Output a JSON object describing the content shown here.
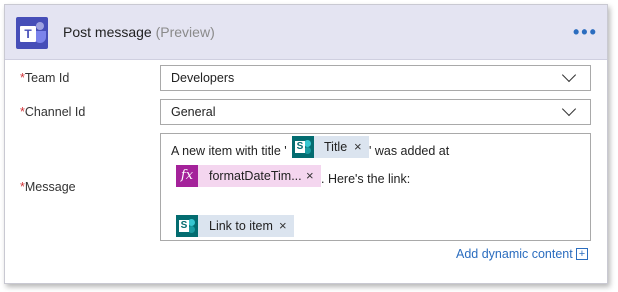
{
  "action": {
    "title": "Post message",
    "preview_tag": "(Preview)",
    "more_label": "•••",
    "logo_letter": "T"
  },
  "fields": {
    "team": {
      "required_mark": "*",
      "label": "Team Id",
      "value": "Developers"
    },
    "channel": {
      "required_mark": "*",
      "label": "Channel Id",
      "value": "General"
    },
    "message": {
      "required_mark": "*",
      "label": "Message",
      "text_1": "A new item with title '",
      "text_2": "' was added at",
      "text_3": ". Here's the link:",
      "tokens": [
        {
          "type": "sharepoint",
          "label": "Title",
          "remove": "×"
        },
        {
          "type": "expression",
          "icon": "fx",
          "label": "formatDateTim...",
          "remove": "×"
        },
        {
          "type": "sharepoint",
          "label": "Link to item",
          "remove": "×"
        }
      ]
    }
  },
  "footer": {
    "add_dynamic_label": "Add dynamic content",
    "add_dynamic_icon": "+"
  },
  "colors": {
    "header_bg": "#e4e4f2",
    "teams_purple": "#464eb8",
    "link_blue": "#2b6dbf",
    "required_red": "#d13438",
    "sharepoint_teal": "#036c70",
    "expression_magenta": "#a4229a"
  }
}
